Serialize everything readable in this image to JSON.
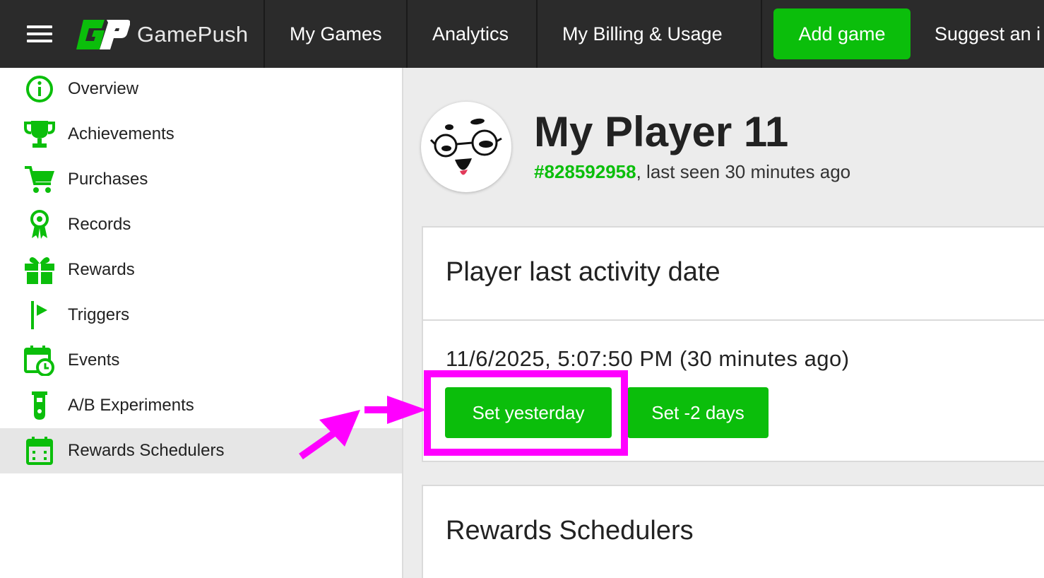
{
  "brand": {
    "name": "GamePush",
    "logo_letters": "GP"
  },
  "topnav": {
    "items": [
      "My Games",
      "Analytics",
      "My Billing & Usage"
    ],
    "add_game": "Add game",
    "suggest": "Suggest an i"
  },
  "sidebar": {
    "items": [
      {
        "label": "Overview",
        "icon": "info-circle-icon"
      },
      {
        "label": "Achievements",
        "icon": "trophy-icon"
      },
      {
        "label": "Purchases",
        "icon": "cart-icon"
      },
      {
        "label": "Records",
        "icon": "award-ribbon-icon"
      },
      {
        "label": "Rewards",
        "icon": "gift-icon"
      },
      {
        "label": "Triggers",
        "icon": "flag-icon"
      },
      {
        "label": "Events",
        "icon": "calendar-clock-icon"
      },
      {
        "label": "A/B Experiments",
        "icon": "test-tube-icon"
      },
      {
        "label": "Rewards Schedulers",
        "icon": "calendar-icon"
      }
    ],
    "active_index": 8
  },
  "player": {
    "name": "My Player 11",
    "id": "#828592958",
    "last_seen": ", last seen 30 minutes ago"
  },
  "activity_card": {
    "title": "Player last activity date",
    "date": "11/6/2025, 5:07:50 PM (30 minutes ago)",
    "btn_yesterday": "Set yesterday",
    "btn_two_days": "Set -2 days"
  },
  "schedulers_card": {
    "title": "Rewards Schedulers"
  },
  "colors": {
    "accent": "#0bbe0b",
    "topbar": "#2b2b2b",
    "annotation": "#ff00ff"
  }
}
